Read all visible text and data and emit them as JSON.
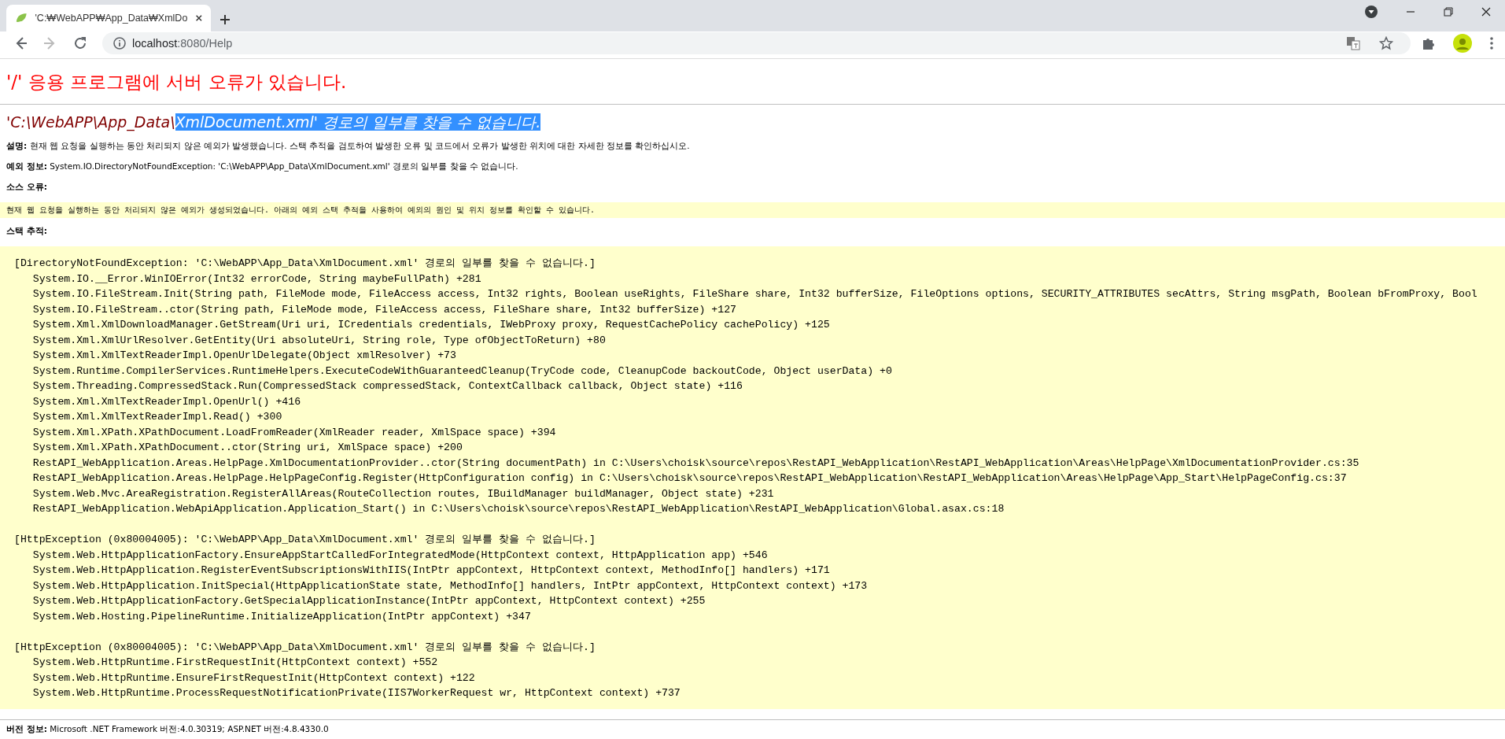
{
  "browser": {
    "tab": {
      "title": "'C:₩WebAPP₩App_Data₩XmlDo",
      "selected": true
    },
    "nav": [
      {
        "kind": "back",
        "disabled": false
      },
      {
        "kind": "forward",
        "disabled": true
      },
      {
        "kind": "reload",
        "disabled": false
      }
    ],
    "address": {
      "host": "localhost",
      "rest": ":8080/Help"
    }
  },
  "page": {
    "title": "'/' 응용 프로그램에 서버 오류가 있습니다.",
    "error_heading": [
      {
        "text": "'C:\\WebAPP\\App_Data\\",
        "selected": false
      },
      {
        "text": "XmlDocument.xml' 경로의 일부를 찾을 수 없습니다.",
        "selected": true
      }
    ],
    "details": [
      {
        "label": "설명:",
        "text": "현재 웹 요청을 실행하는 동안 처리되지 않은 예외가 발생했습니다. 스택 추적을 검토하여 발생한 오류 및 코드에서 오류가 발생한 위치에 대한 자세한 정보를 확인하십시오."
      },
      {
        "label": "예외 정보:",
        "text": "System.IO.DirectoryNotFoundException: 'C:\\WebAPP\\App_Data\\XmlDocument.xml' 경로의 일부를 찾을 수 없습니다."
      }
    ],
    "source_error": {
      "label": "소스 오류:",
      "text": "현재 웹 요청을 실행하는 동안 처리되지 않은 예외가 생성되었습니다. 아래의 예외 스택 추적을 사용하여 예외의 원인 및 위치 정보를 확인할 수 있습니다."
    },
    "stack_trace": {
      "label": "스택 추적:",
      "blocks": [
        {
          "header": "[DirectoryNotFoundException: 'C:\\WebAPP\\App_Data\\XmlDocument.xml' 경로의 일부를 찾을 수 없습니다.]",
          "lines": [
            "System.IO.__Error.WinIOError(Int32 errorCode, String maybeFullPath) +281",
            "System.IO.FileStream.Init(String path, FileMode mode, FileAccess access, Int32 rights, Boolean useRights, FileShare share, Int32 bufferSize, FileOptions options, SECURITY_ATTRIBUTES secAttrs, String msgPath, Boolean bFromProxy, Bool",
            "System.IO.FileStream..ctor(String path, FileMode mode, FileAccess access, FileShare share, Int32 bufferSize) +127",
            "System.Xml.XmlDownloadManager.GetStream(Uri uri, ICredentials credentials, IWebProxy proxy, RequestCachePolicy cachePolicy) +125",
            "System.Xml.XmlUrlResolver.GetEntity(Uri absoluteUri, String role, Type ofObjectToReturn) +80",
            "System.Xml.XmlTextReaderImpl.OpenUrlDelegate(Object xmlResolver) +73",
            "System.Runtime.CompilerServices.RuntimeHelpers.ExecuteCodeWithGuaranteedCleanup(TryCode code, CleanupCode backoutCode, Object userData) +0",
            "System.Threading.CompressedStack.Run(CompressedStack compressedStack, ContextCallback callback, Object state) +116",
            "System.Xml.XmlTextReaderImpl.OpenUrl() +416",
            "System.Xml.XmlTextReaderImpl.Read() +300",
            "System.Xml.XPath.XPathDocument.LoadFromReader(XmlReader reader, XmlSpace space) +394",
            "System.Xml.XPath.XPathDocument..ctor(String uri, XmlSpace space) +200",
            "RestAPI_WebApplication.Areas.HelpPage.XmlDocumentationProvider..ctor(String documentPath) in C:\\Users\\choisk\\source\\repos\\RestAPI_WebApplication\\RestAPI_WebApplication\\Areas\\HelpPage\\XmlDocumentationProvider.cs:35",
            "RestAPI_WebApplication.Areas.HelpPage.HelpPageConfig.Register(HttpConfiguration config) in C:\\Users\\choisk\\source\\repos\\RestAPI_WebApplication\\RestAPI_WebApplication\\Areas\\HelpPage\\App_Start\\HelpPageConfig.cs:37",
            "System.Web.Mvc.AreaRegistration.RegisterAllAreas(RouteCollection routes, IBuildManager buildManager, Object state) +231",
            "RestAPI_WebApplication.WebApiApplication.Application_Start() in C:\\Users\\choisk\\source\\repos\\RestAPI_WebApplication\\RestAPI_WebApplication\\Global.asax.cs:18"
          ]
        },
        {
          "header": "[HttpException (0x80004005): 'C:\\WebAPP\\App_Data\\XmlDocument.xml' 경로의 일부를 찾을 수 없습니다.]",
          "lines": [
            "System.Web.HttpApplicationFactory.EnsureAppStartCalledForIntegratedMode(HttpContext context, HttpApplication app) +546",
            "System.Web.HttpApplication.RegisterEventSubscriptionsWithIIS(IntPtr appContext, HttpContext context, MethodInfo[] handlers) +171",
            "System.Web.HttpApplication.InitSpecial(HttpApplicationState state, MethodInfo[] handlers, IntPtr appContext, HttpContext context) +173",
            "System.Web.HttpApplicationFactory.GetSpecialApplicationInstance(IntPtr appContext, HttpContext context) +255",
            "System.Web.Hosting.PipelineRuntime.InitializeApplication(IntPtr appContext) +347"
          ]
        },
        {
          "header": "[HttpException (0x80004005): 'C:\\WebAPP\\App_Data\\XmlDocument.xml' 경로의 일부를 찾을 수 없습니다.]",
          "lines": [
            "System.Web.HttpRuntime.FirstRequestInit(HttpContext context) +552",
            "System.Web.HttpRuntime.EnsureFirstRequestInit(HttpContext context) +122",
            "System.Web.HttpRuntime.ProcessRequestNotificationPrivate(IIS7WorkerRequest wr, HttpContext context) +737"
          ]
        }
      ]
    },
    "version": {
      "label": "버전 정보:",
      "text": "Microsoft .NET Framework 버전:4.0.30319; ASP.NET 버전:4.8.4330.0"
    }
  }
}
